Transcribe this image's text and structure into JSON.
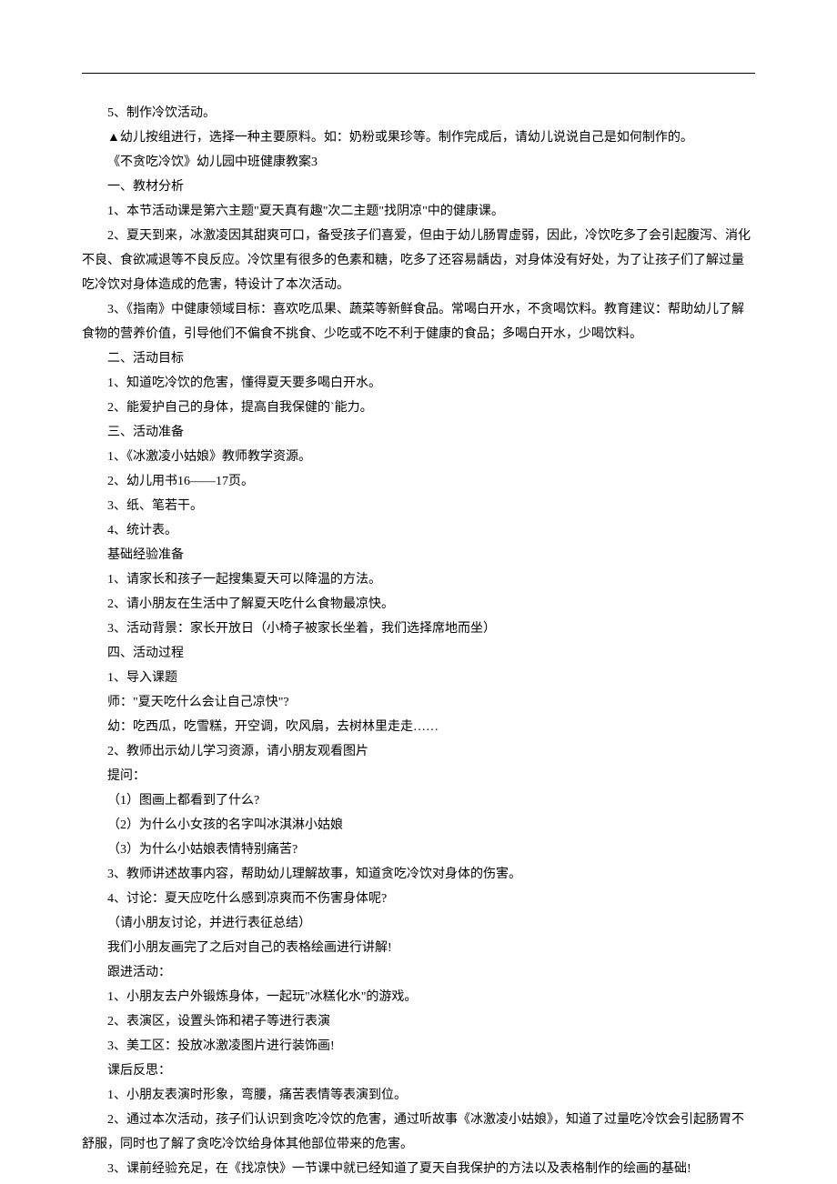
{
  "lines": [
    {
      "t": "5、制作冷饮活动。",
      "i": true
    },
    {
      "t": "▲幼儿按组进行，选择一种主要原料。如：奶粉或果珍等。制作完成后，请幼儿说说自己是如何制作的。",
      "i": true
    },
    {
      "t": "《不贪吃冷饮》幼儿园中班健康教案3",
      "i": true
    },
    {
      "t": "一、教材分析",
      "i": true
    },
    {
      "t": "1、本节活动课是第六主题\"夏天真有趣\"次二主题\"找阴凉\"中的健康课。",
      "i": true
    },
    {
      "t": "2、夏天到来，冰激凌因其甜爽可口，备受孩子们喜爱，但由于幼儿肠胃虚弱，因此，冷饮吃多了会引起腹泻、消化不良、食欲减退等不良反应。冷饮里有很多的色素和糖，吃多了还容易龋齿，对身体没有好处，为了让孩子们了解过量吃冷饮对身体造成的危害，特设计了本次活动。",
      "i": true
    },
    {
      "t": "3、《指南》中健康领域目标：喜欢吃瓜果、蔬菜等新鲜食品。常喝白开水，不贪喝饮料。教育建议：帮助幼儿了解食物的营养价值，引导他们不偏食不挑食、少吃或不吃不利于健康的食品；多喝白开水，少喝饮料。",
      "i": true
    },
    {
      "t": "二、活动目标",
      "i": true
    },
    {
      "t": "1、知道吃冷饮的危害，懂得夏天要多喝白开水。",
      "i": true
    },
    {
      "t": "2、能爱护自己的身体，提高自我保健的`能力。",
      "i": true
    },
    {
      "t": "三、活动准备",
      "i": true
    },
    {
      "t": "1、《冰激凌小姑娘》教师教学资源。",
      "i": true
    },
    {
      "t": "2、幼儿用书16——17页。",
      "i": true
    },
    {
      "t": "3、纸、笔若干。",
      "i": true
    },
    {
      "t": "4、统计表。",
      "i": true
    },
    {
      "t": "基础经验准备",
      "i": true
    },
    {
      "t": "1、请家长和孩子一起搜集夏天可以降温的方法。",
      "i": true
    },
    {
      "t": "2、请小朋友在生活中了解夏天吃什么食物最凉快。",
      "i": true
    },
    {
      "t": "3、活动背景：家长开放日（小椅子被家长坐着，我们选择席地而坐）",
      "i": true
    },
    {
      "t": "四、活动过程",
      "i": true
    },
    {
      "t": "1、导入课题",
      "i": true
    },
    {
      "t": "师：\"夏天吃什么会让自己凉快\"?",
      "i": true
    },
    {
      "t": "幼：吃西瓜，吃雪糕，开空调，吹风扇，去树林里走走……",
      "i": true
    },
    {
      "t": "2、教师出示幼儿学习资源，请小朋友观看图片",
      "i": true
    },
    {
      "t": "提问：",
      "i": true
    },
    {
      "t": "（1）图画上都看到了什么?",
      "i": true
    },
    {
      "t": "（2）为什么小女孩的名字叫冰淇淋小姑娘",
      "i": true
    },
    {
      "t": "（3）为什么小姑娘表情特别痛苦?",
      "i": true
    },
    {
      "t": "3、教师讲述故事内容，帮助幼儿理解故事，知道贪吃冷饮对身体的伤害。",
      "i": true
    },
    {
      "t": "4、讨论：夏天应吃什么感到凉爽而不伤害身体呢?",
      "i": true
    },
    {
      "t": "（请小朋友讨论，并进行表征总结）",
      "i": true
    },
    {
      "t": "我们小朋友画完了之后对自己的表格绘画进行讲解!",
      "i": true
    },
    {
      "t": "跟进活动：",
      "i": true
    },
    {
      "t": "1、小朋友去户外锻炼身体，一起玩\"冰糕化水\"的游戏。",
      "i": true
    },
    {
      "t": "2、表演区，设置头饰和裙子等进行表演",
      "i": true
    },
    {
      "t": "3、美工区：投放冰激凌图片进行装饰画!",
      "i": true
    },
    {
      "t": "课后反思：",
      "i": true
    },
    {
      "t": "1、小朋友表演时形象，弯腰，痛苦表情等表演到位。",
      "i": true
    },
    {
      "t": "2、通过本次活动，孩子们认识到贪吃冷饮的危害，通过听故事《冰激凌小姑娘》，知道了过量吃冷饮会引起肠胃不舒服，同时也了解了贪吃冷饮给身体其他部位带来的危害。",
      "i": true
    },
    {
      "t": "3、课前经验充足，在《找凉快》一节课中就已经知道了夏天自我保护的方法以及表格制作的绘画的基础!",
      "i": true
    }
  ]
}
